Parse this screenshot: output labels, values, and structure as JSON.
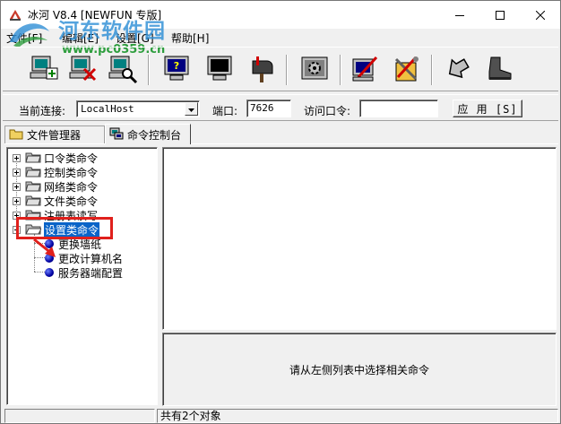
{
  "window": {
    "title": "冰河 V8.4 [NEWFUN 专版]",
    "controls": {
      "minimize": "minimize-icon",
      "maximize": "maximize-icon",
      "close": "close-icon"
    }
  },
  "watermark": {
    "main": "河东软件园",
    "sub": "www.pc0359.cn"
  },
  "menu": [
    {
      "label": "文件[F]"
    },
    {
      "label": "编辑[E]"
    },
    {
      "label": "设置[G]"
    },
    {
      "label": "帮助[H]"
    }
  ],
  "toolbar": {
    "buttons": [
      "add-host-icon",
      "delete-host-icon",
      "auto-search-icon",
      "help-screen-icon",
      "screen-control-icon",
      "mailbox-icon",
      "control-panel-icon",
      "edit-config-icon",
      "tools-icon",
      "back-icon",
      "boot-icon"
    ]
  },
  "connection": {
    "host_label": "当前连接:",
    "host_value": "LocalHost",
    "port_label": "端口:",
    "port_value": "7626",
    "password_label": "访问口令:",
    "password_value": "",
    "apply_label": "应 用 [S]"
  },
  "tabs": [
    {
      "label": "文件管理器",
      "icon": "folder-icon",
      "active": false
    },
    {
      "label": "命令控制台",
      "icon": "console-icon",
      "active": true
    }
  ],
  "tree": {
    "categories": [
      {
        "label": "口令类命令",
        "expanded": false
      },
      {
        "label": "控制类命令",
        "expanded": false
      },
      {
        "label": "网络类命令",
        "expanded": false
      },
      {
        "label": "文件类命令",
        "expanded": false
      },
      {
        "label": "注册表读写",
        "expanded": false
      },
      {
        "label": "设置类命令",
        "expanded": true,
        "selected": true
      }
    ],
    "children": [
      {
        "label": "更换墙纸"
      },
      {
        "label": "更改计算机名"
      },
      {
        "label": "服务器端配置"
      }
    ]
  },
  "panel": {
    "hint": "请从左侧列表中选择相关命令"
  },
  "status": {
    "left": "",
    "right": "共有2个对象"
  },
  "colors": {
    "selection": "#0a64c8",
    "highlight": "#e0201c",
    "watermark_blue": "#2f8fd6",
    "watermark_green": "#2e9e3e"
  }
}
